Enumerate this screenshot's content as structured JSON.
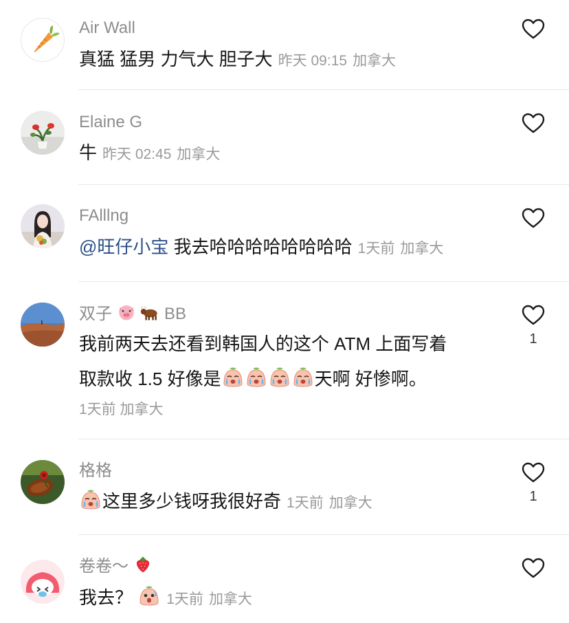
{
  "comments": [
    {
      "username": "Air Wall",
      "text": "真猛 猛男 力气大 胆子大",
      "time": "昨天 09:15",
      "location": "加拿大",
      "likes": ""
    },
    {
      "username": "Elaine G",
      "text": "牛",
      "time": "昨天 02:45",
      "location": "加拿大",
      "likes": ""
    },
    {
      "username": "FAlllng",
      "mention": "@旺仔小宝",
      "text": " 我去哈哈哈哈哈哈哈哈",
      "time": "1天前",
      "location": "加拿大",
      "likes": ""
    },
    {
      "username_prefix": "双子",
      "username_suffix": "BB",
      "line1": "我前两天去还看到韩国人的这个 ATM 上面写着",
      "line2_a": "取款收 1.5 好像是",
      "line2_b": "天啊 好惨啊。",
      "time": "1天前",
      "location": "加拿大",
      "likes": "1"
    },
    {
      "username": "格格",
      "text": "这里多少钱呀我很好奇",
      "time": "1天前",
      "location": "加拿大",
      "likes": "1"
    },
    {
      "username": "卷卷～",
      "text": "我去？",
      "time": "1天前",
      "location": "加拿大",
      "likes": ""
    }
  ],
  "colors": {
    "username": "#8d8d8d",
    "text": "#161616",
    "meta": "#9a9a9a",
    "mention": "#2b4f86",
    "divider": "#e8e8e8"
  }
}
